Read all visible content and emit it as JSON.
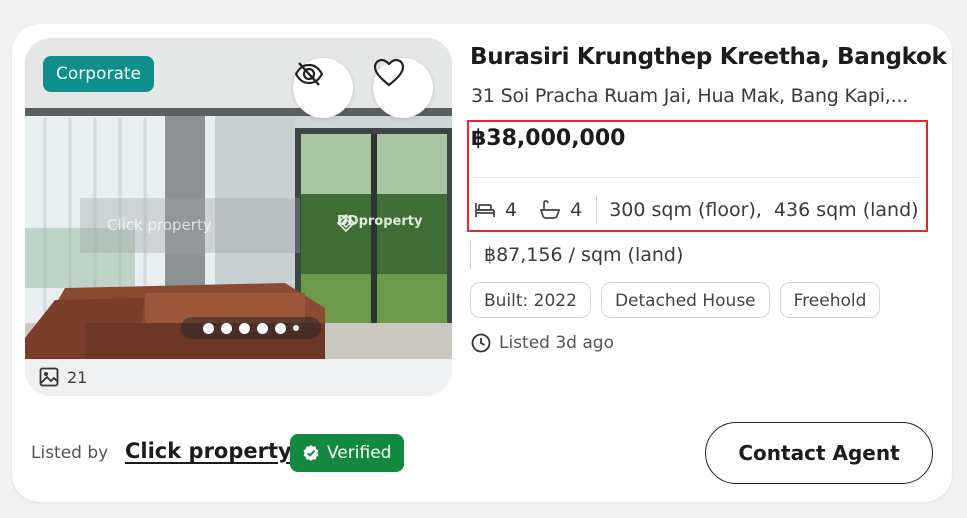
{
  "listing": {
    "badge": "Corporate",
    "title": "Burasiri Krungthep Kreetha, Bangkok",
    "address": "31 Soi Pracha Ruam Jai, Hua Mak, Bang Kapi,...",
    "price": "฿38,000,000",
    "bedrooms": "4",
    "bathrooms": "4",
    "floor_area": "300 sqm (floor),",
    "land_area": "436 sqm (land)",
    "price_per_sqm": "฿87,156 / sqm (land)",
    "tags": [
      "Built: 2022",
      "Detached House",
      "Freehold"
    ],
    "listed_time": "Listed 3d ago"
  },
  "gallery": {
    "photo_count": "21",
    "watermark_text": "Click property",
    "watermark_logo": "DDproperty",
    "slides_total": 6,
    "active_slide": 1
  },
  "agent": {
    "listed_by_label": "Listed by",
    "name": "Click property",
    "verified_label": "Verified"
  },
  "actions": {
    "contact_label": "Contact Agent"
  },
  "colors": {
    "corporate_badge": "#0f8f8c",
    "verified_badge": "#12893f",
    "highlight_border": "#e5262a"
  },
  "icons": [
    "hide-icon",
    "heart-icon",
    "gallery-icon",
    "bed-icon",
    "bath-icon",
    "clock-icon",
    "verified-check-icon"
  ]
}
